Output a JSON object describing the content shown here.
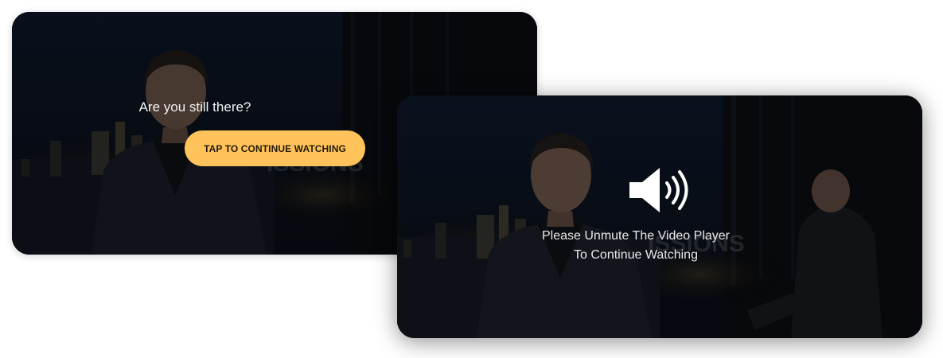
{
  "idle_prompt": {
    "message": "Are you still there?",
    "button_label": "TAP TO CONTINUE WATCHING"
  },
  "unmute_prompt": {
    "icon": "speaker-volume-icon",
    "line1": "Please Unmute The Video Player",
    "line2": "To Continue Watching"
  },
  "colors": {
    "button_bg": "#ffc35b",
    "overlay_text": "#f4f4f4",
    "frame_bg": "#0b0f17"
  }
}
